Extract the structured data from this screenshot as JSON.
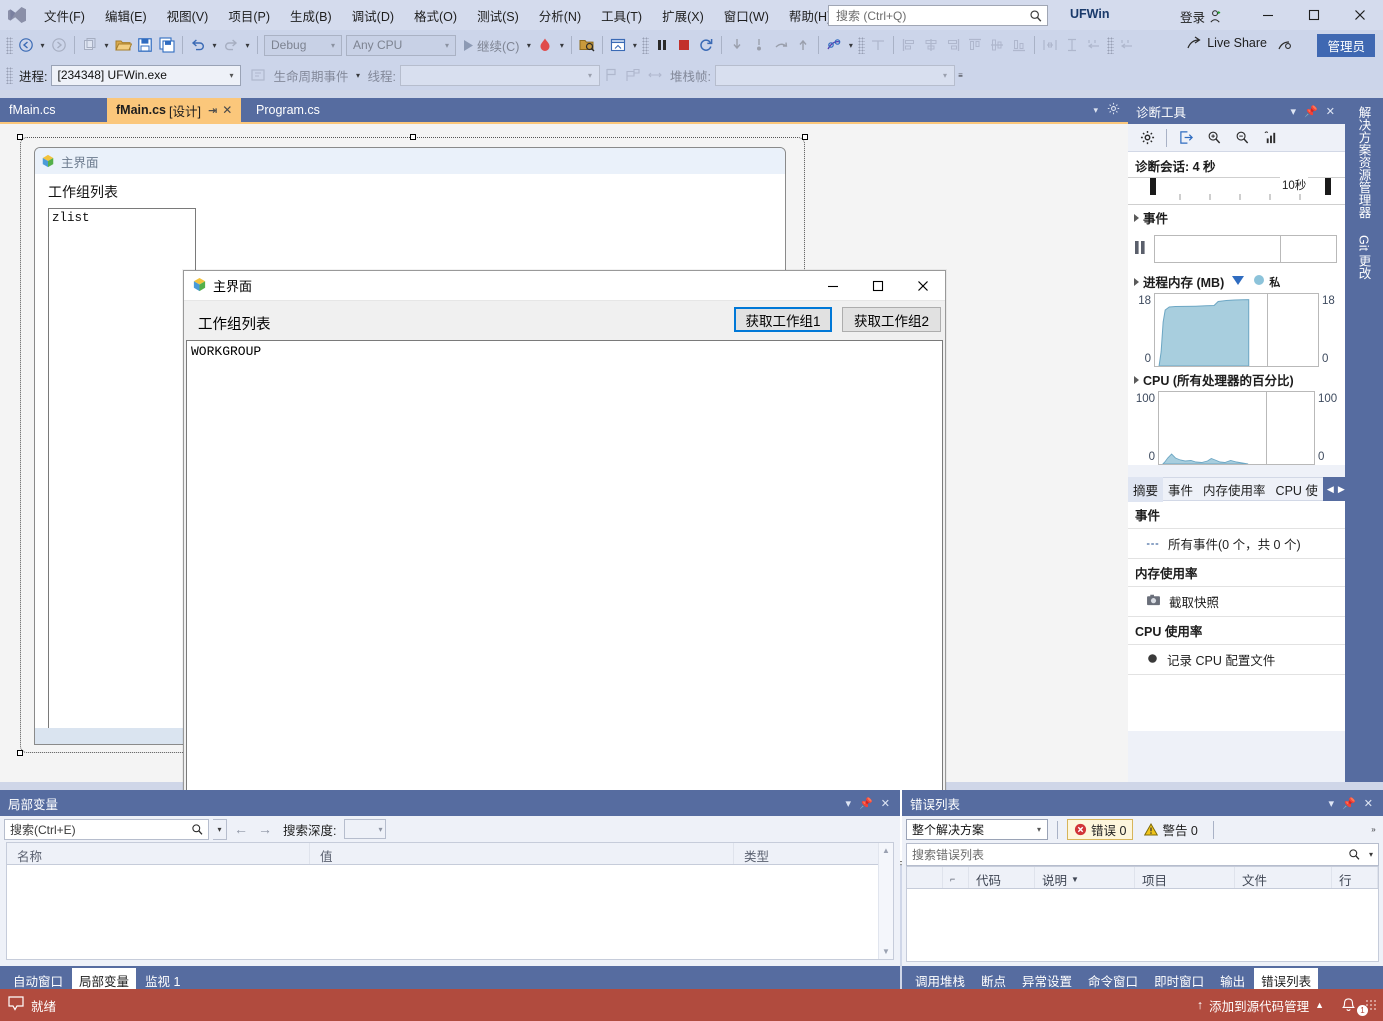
{
  "app": {
    "solution_name": "UFWin",
    "sign_in": "登录",
    "admin_badge": "管理员",
    "live_share": "Live Share"
  },
  "search": {
    "placeholder": "搜索 (Ctrl+Q)"
  },
  "menu": [
    "文件(F)",
    "编辑(E)",
    "视图(V)",
    "项目(P)",
    "生成(B)",
    "调试(D)",
    "格式(O)",
    "测试(S)",
    "分析(N)",
    "工具(T)",
    "扩展(X)",
    "窗口(W)",
    "帮助(H)"
  ],
  "toolbar": {
    "config": "Debug",
    "platform": "Any CPU",
    "continue_label": "继续(C)"
  },
  "debugbar": {
    "process_label": "进程:",
    "process_value": "[234348] UFWin.exe",
    "lifecycle_label": "生命周期事件",
    "thread_label": "线程:",
    "thread_value": "",
    "stackframe_label": "堆栈帧:",
    "stackframe_value": ""
  },
  "editor_tabs": [
    {
      "label": "fMain.cs",
      "active": false
    },
    {
      "label": "fMain.cs",
      "sub": "[设计]",
      "active": true
    },
    {
      "label": "Program.cs",
      "active": false
    }
  ],
  "designer": {
    "form_title": "主界面",
    "group_label": "工作组列表",
    "list_value": "zlist"
  },
  "appwindow": {
    "title": "主界面",
    "group_label": "工作组列表",
    "button1": "获取工作组1",
    "button2": "获取工作组2",
    "output_text": "WORKGROUP"
  },
  "diagnostics": {
    "title": "诊断工具",
    "session_label": "诊断会话: 4 秒",
    "ruler_label": "10秒",
    "events_section": "事件",
    "memory_section": "进程内存 (MB)",
    "cpu_section": "CPU (所有处理器的百分比)",
    "tabs": [
      {
        "label": "摘要",
        "active": true
      },
      {
        "label": "事件",
        "active": false
      },
      {
        "label": "内存使用率",
        "active": false
      },
      {
        "label": "CPU 使",
        "active": false
      }
    ],
    "summary": [
      {
        "header": "事件",
        "item": "所有事件(0 个，共 0 个)",
        "icon": "events-icon"
      },
      {
        "header": "内存使用率",
        "item": "截取快照",
        "icon": "camera-icon"
      },
      {
        "header": "CPU 使用率",
        "item": "记录 CPU 配置文件",
        "icon": "record-icon"
      }
    ]
  },
  "chart_data": [
    {
      "type": "area",
      "title": "进程内存 (MB)",
      "ylabel_left": "18",
      "ylabel_right": "18",
      "ymin_label": "0",
      "ylim": [
        0,
        18
      ],
      "x": [
        0,
        2,
        4,
        6,
        8,
        12,
        16,
        20,
        24,
        30,
        36,
        42,
        48,
        52,
        56,
        60,
        64,
        68
      ],
      "values": [
        0,
        0,
        2,
        9,
        13,
        14,
        14,
        14,
        14,
        14.2,
        14.4,
        14.5,
        15.8,
        16,
        16.1,
        16.2,
        16.3,
        16.3
      ],
      "grid": false,
      "legend": "none"
    },
    {
      "type": "area",
      "title": "CPU (所有处理器的百分比)",
      "ylabel_left": "100",
      "ylabel_right": "100",
      "ymin_label": "0",
      "ylim": [
        0,
        100
      ],
      "x": [
        0,
        4,
        8,
        12,
        16,
        20,
        24,
        28,
        32,
        36,
        40,
        44,
        48,
        52,
        56,
        60
      ],
      "values": [
        0,
        2,
        7,
        5,
        3,
        4,
        2,
        2,
        3,
        2,
        1,
        4,
        5,
        2,
        2,
        0
      ],
      "grid": false,
      "legend": "none"
    }
  ],
  "vertical_tabs": [
    "解决方案资源管理器",
    "Git 更改"
  ],
  "locals": {
    "title": "局部变量",
    "search_placeholder": "搜索(Ctrl+E)",
    "depth_label": "搜索深度:",
    "depth_value": "",
    "columns": [
      "名称",
      "值",
      "类型"
    ],
    "rows": []
  },
  "errorlist": {
    "title": "错误列表",
    "scope": "整个解决方案",
    "errors_label": "错误 0",
    "warnings_label": "警告 0",
    "search_placeholder": "搜索错误列表",
    "columns": [
      "",
      "",
      "代码",
      "说明",
      "项目",
      "文件",
      "行"
    ],
    "rows": []
  },
  "bottom_tabs_left": [
    {
      "label": "自动窗口",
      "active": false
    },
    {
      "label": "局部变量",
      "active": true
    },
    {
      "label": "监视 1",
      "active": false
    }
  ],
  "bottom_tabs_right": [
    {
      "label": "调用堆栈",
      "active": false
    },
    {
      "label": "断点",
      "active": false
    },
    {
      "label": "异常设置",
      "active": false
    },
    {
      "label": "命令窗口",
      "active": false
    },
    {
      "label": "即时窗口",
      "active": false
    },
    {
      "label": "输出",
      "active": false
    },
    {
      "label": "错误列表",
      "active": true
    }
  ],
  "statusbar": {
    "state": "就绪",
    "source_control": "添加到源代码管理",
    "notification_count": "1"
  },
  "colors": {
    "accent": "#566ca0",
    "status": "#b14b3e",
    "active_tab": "#fbc77b",
    "chart_fill": "#a8cede",
    "admin": "#3f68b2"
  }
}
